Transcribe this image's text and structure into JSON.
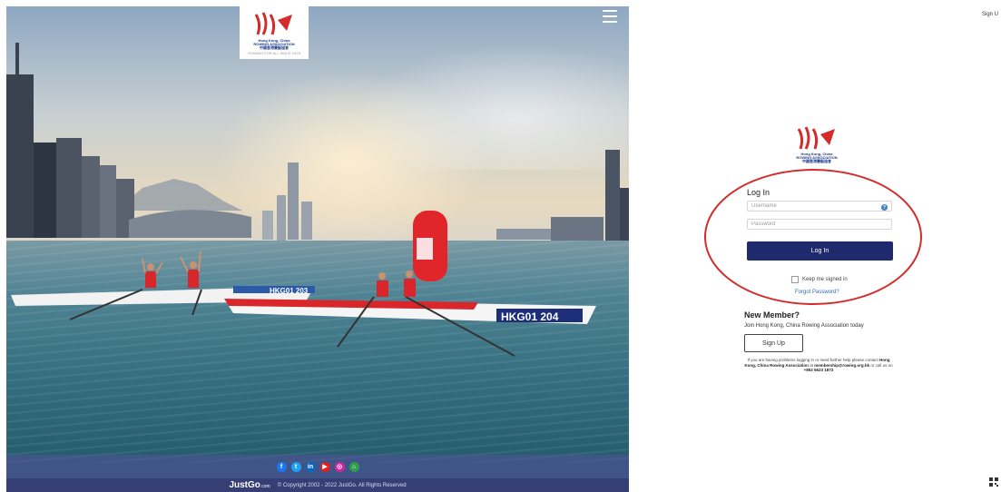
{
  "hero": {
    "logo": {
      "org_line1": "Hong Kong, China",
      "org_line2": "ROWING ASSOCIATION",
      "org_chinese": "中國香港賽艇協會",
      "tagline": "ROWING FOR ALL SINCE 1978"
    },
    "menu_icon": "hamburger-menu-icon",
    "boat_numbers": [
      "HKG01 204",
      "HKG01 203"
    ],
    "social_icons": [
      {
        "name": "facebook-icon",
        "glyph": "f",
        "color": "#1877f2"
      },
      {
        "name": "twitter-icon",
        "glyph": "t",
        "color": "#1da1f2"
      },
      {
        "name": "linkedin-icon",
        "glyph": "in",
        "color": "#0a66c2"
      },
      {
        "name": "youtube-icon",
        "glyph": "▶",
        "color": "#e02020"
      },
      {
        "name": "instagram-icon",
        "glyph": "◎",
        "color": "#d6249f"
      },
      {
        "name": "home-icon",
        "glyph": "⌂",
        "color": "#2e9e4a"
      }
    ],
    "footer": {
      "brand": "JustGo",
      "brand_suffix": ".com",
      "copyright": "© Copyright 2002 - 2022 JustGo. All Rights Reserved"
    }
  },
  "header": {
    "signup_link": "Sign U"
  },
  "login": {
    "logo": {
      "org_line1": "Hong Kong, China",
      "org_line2": "ROWING ASSOCIATION",
      "org_chinese": "中國香港賽艇協會"
    },
    "title": "Log In",
    "username_placeholder": "Username",
    "password_placeholder": "Password",
    "login_button": "Log In",
    "keep_signed_in": "Keep me signed in",
    "forgot_password": "Forgot Password?",
    "highlight_color": "#d42b2b",
    "button_color": "#1f2a6e"
  },
  "new_member": {
    "title": "New Member?",
    "join_text": "Join Hong Kong, China Rowing Association today",
    "signup_button": "Sign Up",
    "help_prefix": "If you are having problems logging in or need further help please contact",
    "help_org": "Hong Kong, China Rowing Association",
    "help_at": "at",
    "help_email": "membership@rowing.org.hk",
    "help_or": "or call us on",
    "help_phone": "+852 5623 1872"
  }
}
